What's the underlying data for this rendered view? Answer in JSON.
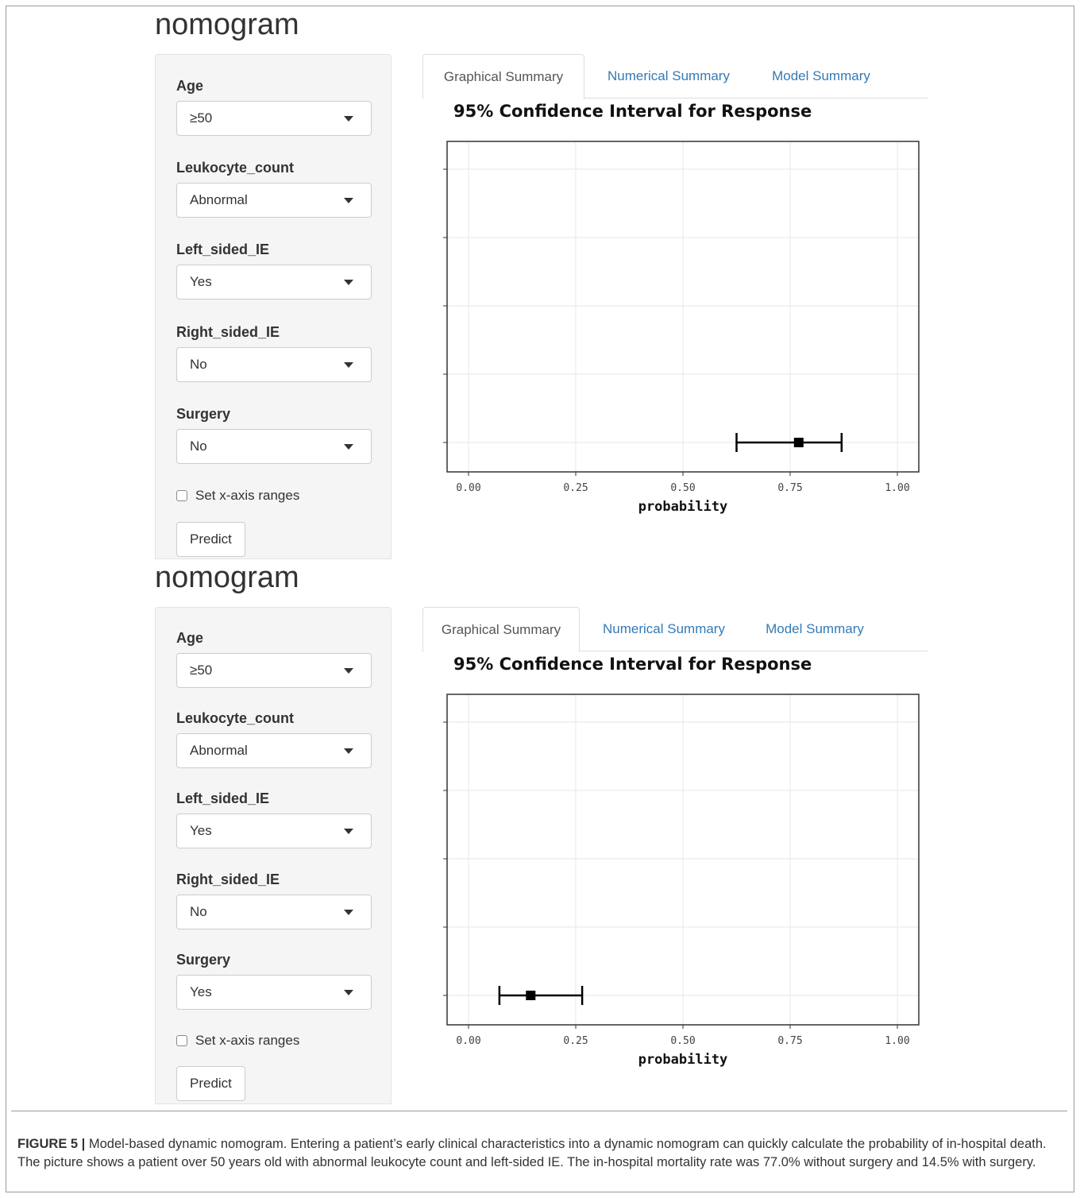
{
  "apps": [
    {
      "title": "nomogram",
      "inputs": {
        "age_label": "Age",
        "age_value": "≥50",
        "leukocyte_label": "Leukocyte_count",
        "leukocyte_value": "Abnormal",
        "left_label": "Left_sided_IE",
        "left_value": "Yes",
        "right_label": "Right_sided_IE",
        "right_value": "No",
        "surgery_label": "Surgery",
        "surgery_value": "No"
      },
      "checkbox_label": "Set x-axis ranges",
      "predict_label": "Predict",
      "tabs": [
        "Graphical Summary",
        "Numerical Summary",
        "Model Summary"
      ],
      "plot_title": "95% Confidence Interval for Response",
      "chart_data": {
        "type": "scatter",
        "title": "95% Confidence Interval for Response",
        "xlabel": "probability",
        "xlim": [
          -0.05,
          1.05
        ],
        "xticks": [
          "0.00",
          "0.25",
          "0.50",
          "0.75",
          "1.00"
        ],
        "y_positions": 5,
        "point": 0.77,
        "ci": [
          0.625,
          0.87
        ],
        "row": 5
      }
    },
    {
      "title": "nomogram",
      "inputs": {
        "age_label": "Age",
        "age_value": "≥50",
        "leukocyte_label": "Leukocyte_count",
        "leukocyte_value": "Abnormal",
        "left_label": "Left_sided_IE",
        "left_value": "Yes",
        "right_label": "Right_sided_IE",
        "right_value": "No",
        "surgery_label": "Surgery",
        "surgery_value": "Yes"
      },
      "checkbox_label": "Set x-axis ranges",
      "predict_label": "Predict",
      "tabs": [
        "Graphical Summary",
        "Numerical Summary",
        "Model Summary"
      ],
      "plot_title": "95% Confidence Interval for Response",
      "chart_data": {
        "type": "scatter",
        "title": "95% Confidence Interval for Response",
        "xlabel": "probability",
        "xlim": [
          -0.05,
          1.05
        ],
        "xticks": [
          "0.00",
          "0.25",
          "0.50",
          "0.75",
          "1.00"
        ],
        "y_positions": 5,
        "point": 0.145,
        "ci": [
          0.072,
          0.265
        ],
        "row": 5
      }
    }
  ],
  "caption": {
    "label": "FIGURE 5 |",
    "text": " Model-based dynamic nomogram. Entering a patient’s early clinical characteristics into a dynamic nomogram can quickly calculate the probability of in-hospital death. The picture shows a patient over 50 years old with abnormal leukocyte count and left-sided IE. The in-hospital mortality rate was 77.0% without surgery and 14.5% with surgery."
  },
  "colors": {
    "link": "#337ab7",
    "panel_bg": "#f5f5f5",
    "grid": "#ebebeb",
    "ink": "#000000"
  }
}
